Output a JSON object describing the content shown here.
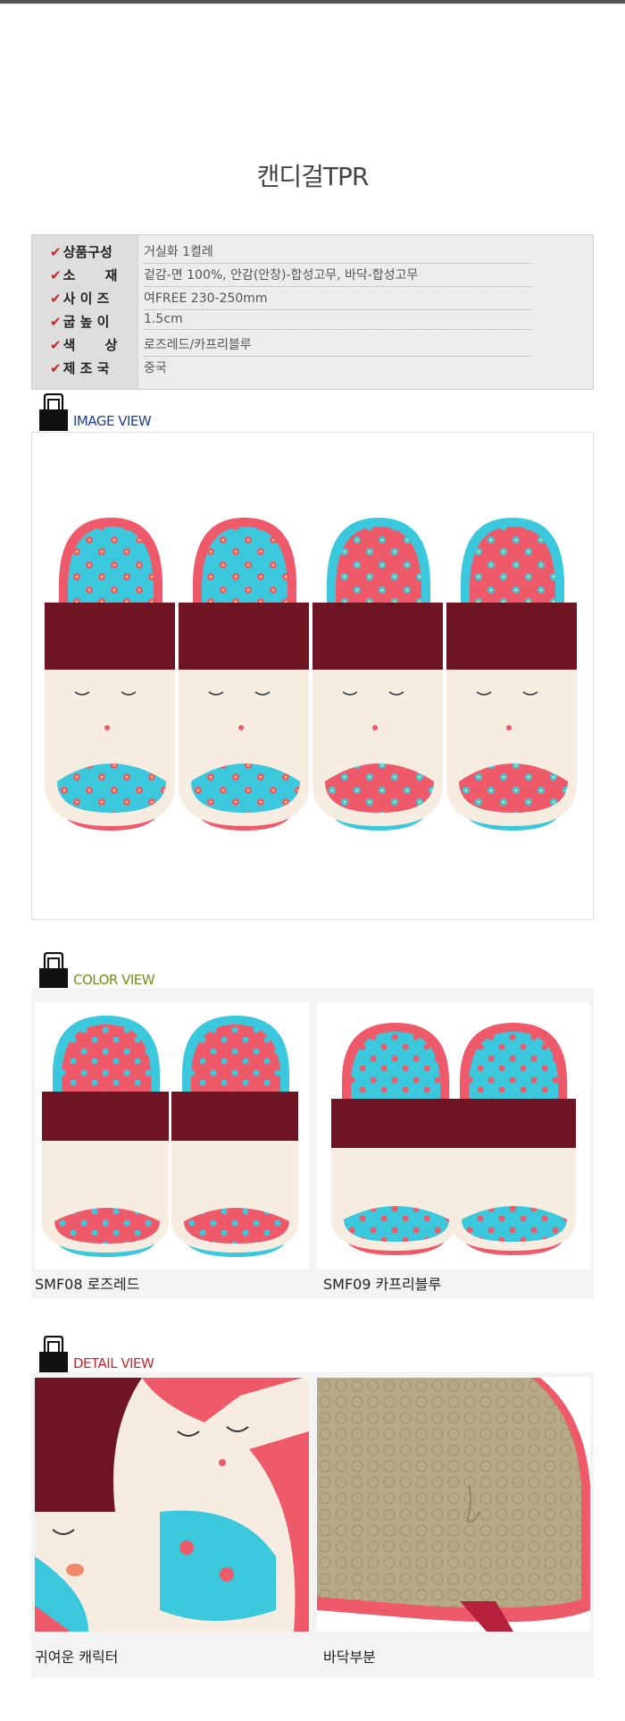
{
  "title": "캔디걸TPR",
  "spec": [
    {
      "label": "상품구성",
      "value": "거실화 1켤레"
    },
    {
      "label": "소  재",
      "value": "겉감-면 100%, 안감(안창)-합성고무, 바닥-합성고무"
    },
    {
      "label": "사 이 즈",
      "value": "여FREE 230-250mm"
    },
    {
      "label": "굽 높 이",
      "value": "1.5cm"
    },
    {
      "label": "색  상",
      "value": "로즈레드/카프리블루"
    },
    {
      "label": "제 조 국",
      "value": "중국"
    }
  ],
  "check_mark": "✔",
  "sections": {
    "image_view": {
      "label": "IMAGE VIEW",
      "color": "#1f3f8f"
    },
    "color_view": {
      "label": "COLOR VIEW",
      "color": "#7a8a1a"
    },
    "detail_view": {
      "label": "DETAIL VIEW",
      "color": "#c0282f"
    }
  },
  "color_items": [
    {
      "caption": "SMF08 로즈레드"
    },
    {
      "caption": "SMF09 카프리블루"
    }
  ],
  "detail_items": [
    {
      "caption": "귀여운 캐릭터"
    },
    {
      "caption": "바닥부분"
    }
  ],
  "colors": {
    "pink": "#ee5a6a",
    "cyan": "#3cc8dc",
    "maroon": "#6e1422",
    "cream": "#f6ece0"
  }
}
